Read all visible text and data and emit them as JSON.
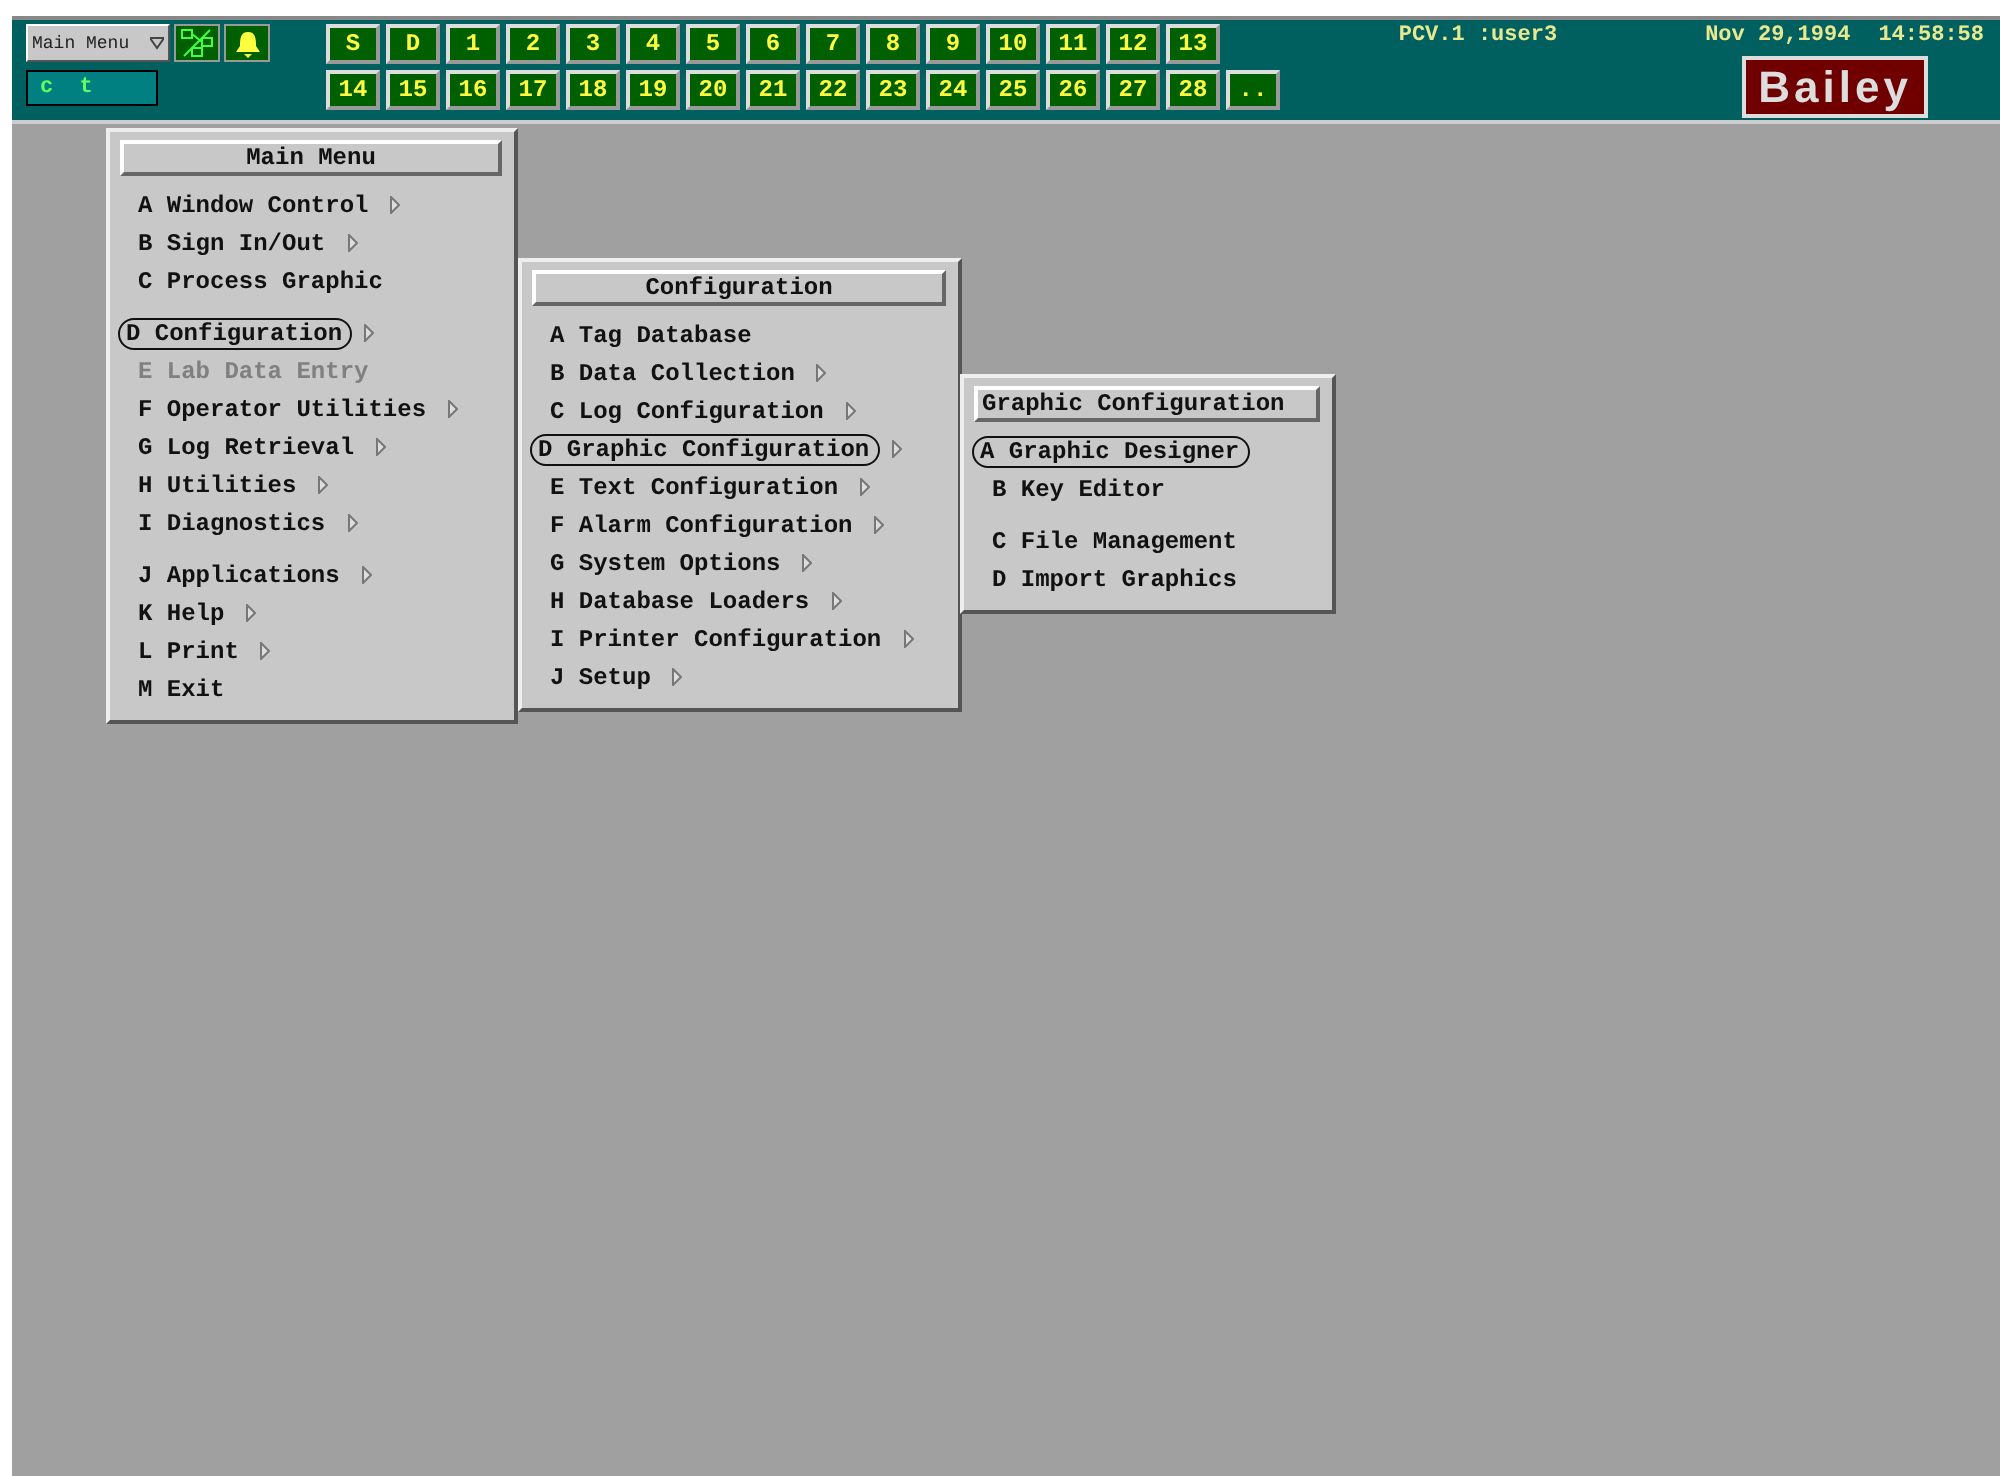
{
  "top_bar": {
    "menu_select": "Main Menu",
    "command_field": "c  t",
    "keys_row_1": [
      {
        "label": "S"
      },
      {
        "label": "D"
      },
      {
        "label": "1"
      },
      {
        "label": "2"
      },
      {
        "label": "3"
      },
      {
        "label": "4"
      },
      {
        "label": "5"
      },
      {
        "label": "6"
      },
      {
        "label": "7"
      },
      {
        "label": "8"
      },
      {
        "label": "9"
      },
      {
        "label": "10"
      },
      {
        "label": "11"
      },
      {
        "label": "12"
      },
      {
        "label": "13"
      }
    ],
    "keys_row_2": [
      {
        "label": "14"
      },
      {
        "label": "15"
      },
      {
        "label": "16"
      },
      {
        "label": "17"
      },
      {
        "label": "18"
      },
      {
        "label": "19"
      },
      {
        "label": "20"
      },
      {
        "label": "21"
      },
      {
        "label": "22"
      },
      {
        "label": "23"
      },
      {
        "label": "24"
      },
      {
        "label": "25"
      },
      {
        "label": "26"
      },
      {
        "label": "27"
      },
      {
        "label": "28"
      }
    ],
    "more_key": "..",
    "node_user": "PCV.1 :user3",
    "date": "Nov 29,1994",
    "time": "14:58:58",
    "logo": "Bailey"
  },
  "menus": [
    {
      "title": "Main Menu",
      "groups": [
        {
          "items": [
            {
              "label": "A Window Control",
              "submenu": true,
              "selected": false,
              "disabled": false
            },
            {
              "label": "B Sign In/Out",
              "submenu": true,
              "selected": false,
              "disabled": false
            },
            {
              "label": "C Process Graphic",
              "submenu": false,
              "selected": false,
              "disabled": false
            }
          ]
        },
        {
          "items": [
            {
              "label": "D Configuration",
              "submenu": true,
              "selected": true,
              "disabled": false
            },
            {
              "label": "E Lab Data Entry",
              "submenu": false,
              "selected": false,
              "disabled": true
            },
            {
              "label": "F Operator Utilities",
              "submenu": true,
              "selected": false,
              "disabled": false
            },
            {
              "label": "G Log Retrieval",
              "submenu": true,
              "selected": false,
              "disabled": false
            },
            {
              "label": "H Utilities",
              "submenu": true,
              "selected": false,
              "disabled": false
            },
            {
              "label": "I Diagnostics",
              "submenu": true,
              "selected": false,
              "disabled": false
            }
          ]
        },
        {
          "items": [
            {
              "label": "J Applications",
              "submenu": true,
              "selected": false,
              "disabled": false
            },
            {
              "label": "K Help",
              "submenu": true,
              "selected": false,
              "disabled": false
            },
            {
              "label": "L Print",
              "submenu": true,
              "selected": false,
              "disabled": false
            },
            {
              "label": "M Exit",
              "submenu": false,
              "selected": false,
              "disabled": false
            }
          ]
        }
      ]
    },
    {
      "title": "Configuration",
      "groups": [
        {
          "items": [
            {
              "label": "A Tag Database",
              "submenu": false,
              "selected": false,
              "disabled": false
            },
            {
              "label": "B Data Collection",
              "submenu": true,
              "selected": false,
              "disabled": false
            },
            {
              "label": "C Log Configuration",
              "submenu": true,
              "selected": false,
              "disabled": false
            },
            {
              "label": "D Graphic Configuration",
              "submenu": true,
              "selected": true,
              "disabled": false
            },
            {
              "label": "E Text Configuration",
              "submenu": true,
              "selected": false,
              "disabled": false
            },
            {
              "label": "F Alarm Configuration",
              "submenu": true,
              "selected": false,
              "disabled": false
            },
            {
              "label": "G System Options",
              "submenu": true,
              "selected": false,
              "disabled": false
            },
            {
              "label": "H Database Loaders",
              "submenu": true,
              "selected": false,
              "disabled": false
            },
            {
              "label": "I Printer Configuration",
              "submenu": true,
              "selected": false,
              "disabled": false
            },
            {
              "label": "J Setup",
              "submenu": true,
              "selected": false,
              "disabled": false
            }
          ]
        }
      ]
    },
    {
      "title": "Graphic Configuration",
      "groups": [
        {
          "items": [
            {
              "label": "A Graphic Designer",
              "submenu": false,
              "selected": true,
              "disabled": false
            },
            {
              "label": "B Key Editor",
              "submenu": false,
              "selected": false,
              "disabled": false
            }
          ]
        },
        {
          "items": [
            {
              "label": "C File Management",
              "submenu": false,
              "selected": false,
              "disabled": false
            },
            {
              "label": "D Import Graphics",
              "submenu": false,
              "selected": false,
              "disabled": false
            }
          ]
        }
      ]
    }
  ]
}
